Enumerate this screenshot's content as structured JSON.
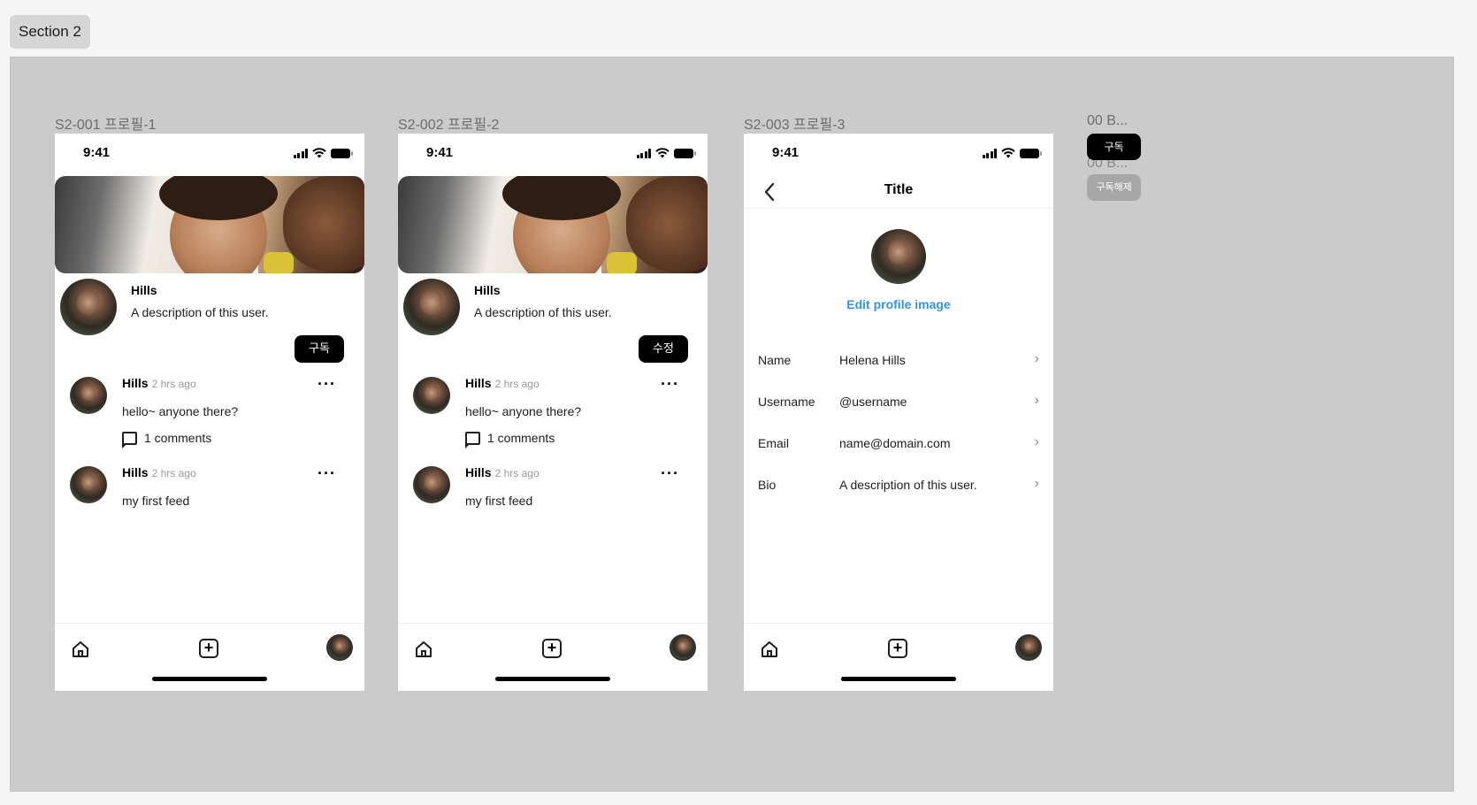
{
  "section": {
    "label": "Section 2"
  },
  "frames": {
    "f1": {
      "label": "S2-001 프로필-1"
    },
    "f2": {
      "label": "S2-002 프로필-2"
    },
    "f3": {
      "label": "S2-003 프로필-3"
    }
  },
  "status": {
    "time": "9:41"
  },
  "profile": {
    "name": "Hills",
    "description": "A description of this user."
  },
  "buttons": {
    "subscribe": "구독",
    "edit": "수정",
    "unsubscribe": "구독해제"
  },
  "posts": [
    {
      "author": "Hills",
      "time": "2 hrs ago",
      "text": "hello~ anyone there?",
      "comments": "1 comments"
    },
    {
      "author": "Hills",
      "time": "2 hrs ago",
      "text": "my first feed"
    }
  ],
  "more_label": "···",
  "edit_screen": {
    "back_icon": "chevron-left-icon",
    "title": "Title",
    "edit_image": "Edit profile image",
    "rows": [
      {
        "label": "Name",
        "value": "Helena Hills"
      },
      {
        "label": "Username",
        "value": "@username"
      },
      {
        "label": "Email",
        "value": "name@domain.com"
      },
      {
        "label": "Bio",
        "value": "A description of this user."
      }
    ]
  },
  "components": {
    "label_1": "00 B...",
    "label_2": "00 B..."
  },
  "colors": {
    "accent_link": "#2f95e8",
    "canvas": "#cbcbcb",
    "button_dark": "#000000",
    "button_muted": "#a7a7a7"
  }
}
